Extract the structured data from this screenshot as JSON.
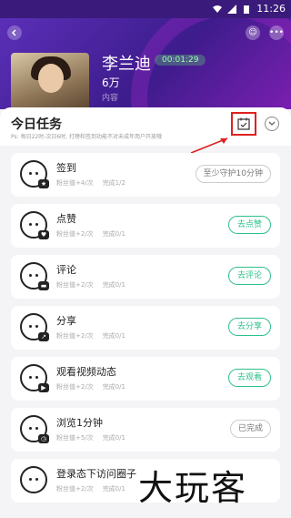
{
  "status_bar": {
    "time": "11:26"
  },
  "header": {
    "anchor_name": "李兰迪",
    "duration": "00:01:29",
    "fans_count": "6万",
    "sub_label": "内容"
  },
  "sheet": {
    "title": "今日任务",
    "note": "Ps: 每日22时-次日6时, 打榜和签到功能不对未成年用户开放哦"
  },
  "tasks": [
    {
      "name": "签到",
      "points": "粉丝值+4/次",
      "progress": "完成1/2",
      "action": "至少守护10分钟",
      "state": "disabled"
    },
    {
      "name": "点赞",
      "points": "粉丝值+2/次",
      "progress": "完成0/1",
      "action": "去点赞",
      "state": "active"
    },
    {
      "name": "评论",
      "points": "粉丝值+2/次",
      "progress": "完成0/1",
      "action": "去评论",
      "state": "active"
    },
    {
      "name": "分享",
      "points": "粉丝值+2/次",
      "progress": "完成0/1",
      "action": "去分享",
      "state": "active"
    },
    {
      "name": "观看视频动态",
      "points": "粉丝值+2/次",
      "progress": "完成0/1",
      "action": "去观看",
      "state": "active"
    },
    {
      "name": "浏览1分钟",
      "points": "粉丝值+5/次",
      "progress": "完成0/1",
      "action": "已完成",
      "state": "disabled"
    },
    {
      "name": "登录态下访问圈子",
      "points": "粉丝值+2/次",
      "progress": "完成0/1",
      "action": "",
      "state": "hidden"
    }
  ],
  "watermark": "大玩客",
  "colors": {
    "accent_green": "#2ec08a",
    "header_purple": "#4a249c",
    "highlight_red": "#e02020"
  }
}
